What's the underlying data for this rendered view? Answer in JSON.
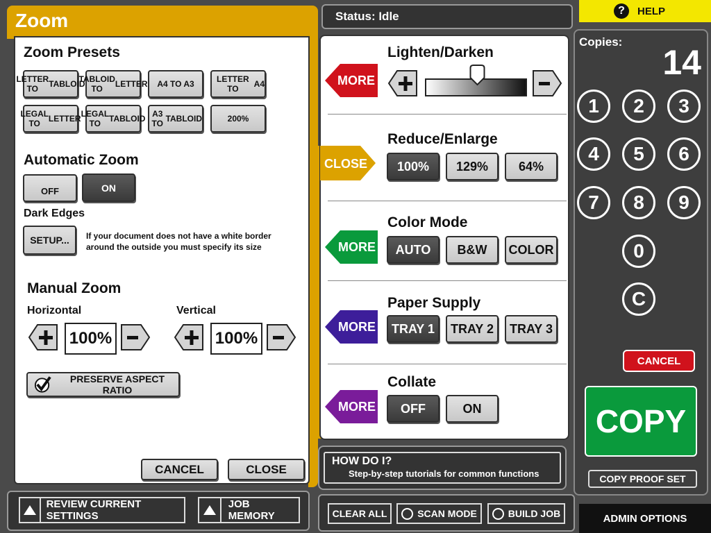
{
  "left": {
    "title": "Zoom",
    "presets_heading": "Zoom Presets",
    "presets": [
      [
        "LETTER TO",
        "TABLOID"
      ],
      [
        "TABLOID TO",
        "LETTER"
      ],
      [
        "A4 TO A3",
        ""
      ],
      [
        "LETTER TO",
        "A4"
      ],
      [
        "LEGAL TO",
        "LETTER"
      ],
      [
        "LEGAL TO",
        "TABLOID"
      ],
      [
        "A3 TO",
        "TABLOID"
      ],
      [
        "200%",
        ""
      ]
    ],
    "auto_heading": "Automatic Zoom",
    "auto_off": "OFF",
    "auto_on": "ON",
    "dark_edges": "Dark Edges",
    "setup": "SETUP...",
    "setup_note_1": "If your document does not have a white border",
    "setup_note_2": "around the outside you must specify its size",
    "manual_heading": "Manual Zoom",
    "horizontal_label": "Horizontal",
    "horizontal_value": "100%",
    "vertical_label": "Vertical",
    "vertical_value": "100%",
    "preserve": "PRESERVE ASPECT RATIO",
    "cancel": "CANCEL",
    "close": "CLOSE"
  },
  "status": "Status: Idle",
  "sections": {
    "lighten": {
      "title": "Lighten/Darken",
      "tab": "MORE",
      "tab_color": "#d0121c",
      "slider_value": 0.5
    },
    "reduce": {
      "title": "Reduce/Enlarge",
      "tab": "CLOSE",
      "tab_color": "#dca200",
      "options": [
        "100%",
        "129%",
        "64%"
      ],
      "selected": "100%"
    },
    "color": {
      "title": "Color Mode",
      "tab": "MORE",
      "tab_color": "#0a9a3c",
      "options": [
        "AUTO",
        "B&W",
        "COLOR"
      ],
      "selected": "AUTO"
    },
    "paper": {
      "title": "Paper Supply",
      "tab": "MORE",
      "tab_color": "#3d1e9a",
      "options": [
        "TRAY 1",
        "TRAY 2",
        "TRAY 3"
      ],
      "selected": "TRAY 1"
    },
    "collate": {
      "title": "Collate",
      "tab": "MORE",
      "tab_color": "#7a1c9a",
      "options": [
        "OFF",
        "ON"
      ],
      "selected": "OFF"
    }
  },
  "howdoi": {
    "title": "HOW DO I?",
    "subtitle": "Step-by-step tutorials for common functions"
  },
  "right": {
    "help": "HELP",
    "copies_label": "Copies:",
    "copies": "14",
    "keys": [
      "1",
      "2",
      "3",
      "4",
      "5",
      "6",
      "7",
      "8",
      "9",
      "0",
      "C"
    ],
    "cancel": "CANCEL",
    "copy": "COPY",
    "proof": "COPY PROOF SET",
    "admin": "ADMIN OPTIONS"
  },
  "bottom": {
    "review": "REVIEW CURRENT SETTINGS",
    "job_memory": "JOB MEMORY",
    "clear_all": "CLEAR ALL",
    "scan_mode": "SCAN MODE",
    "build_job": "BUILD JOB"
  }
}
